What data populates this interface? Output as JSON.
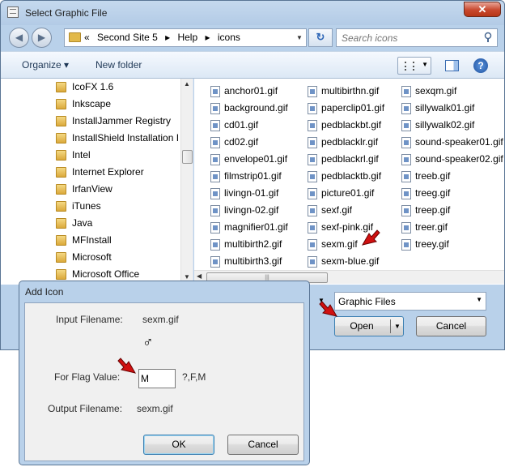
{
  "window": {
    "title": "Select Graphic File",
    "close_glyph": "✕"
  },
  "nav": {
    "back_glyph": "◀",
    "forward_glyph": "▶",
    "crumbs": [
      "«",
      "Second Site 5",
      "▸",
      "Help",
      "▸",
      "icons"
    ],
    "refresh_glyph": "↻",
    "search_placeholder": "Search icons"
  },
  "toolbar": {
    "organize": "Organize ▾",
    "new_folder": "New folder",
    "help": "?"
  },
  "tree": {
    "items": [
      "IcoFX 1.6",
      "Inkscape",
      "InstallJammer Registry",
      "InstallShield Installation I",
      "Intel",
      "Internet Explorer",
      "IrfanView",
      "iTunes",
      "Java",
      "MFInstall",
      "Microsoft",
      "Microsoft Office"
    ]
  },
  "files": {
    "col1": [
      "anchor01.gif",
      "background.gif",
      "cd01.gif",
      "cd02.gif",
      "envelope01.gif",
      "filmstrip01.gif",
      "livingn-01.gif",
      "livingn-02.gif",
      "magnifier01.gif",
      "multibirth2.gif",
      "multibirth3.gif"
    ],
    "col2": [
      "multibirthn.gif",
      "paperclip01.gif",
      "pedblackbt.gif",
      "pedblacklr.gif",
      "pedblackrl.gif",
      "pedblacktb.gif",
      "picture01.gif",
      "sexf.gif",
      "sexf-pink.gif",
      "sexm.gif",
      "sexm-blue.gif"
    ],
    "col3": [
      "sexqm.gif",
      "sillywalk01.gif",
      "sillywalk02.gif",
      "sound-speaker01.gif",
      "sound-speaker02.gif",
      "treeb.gif",
      "treeg.gif",
      "treep.gif",
      "treer.gif",
      "treey.gif"
    ]
  },
  "bottom": {
    "file_type": "Graphic Files",
    "open": "Open",
    "cancel": "Cancel"
  },
  "dialog": {
    "title": "Add Icon",
    "input_filename_label": "Input Filename:",
    "input_filename_value": "sexm.gif",
    "symbol": "♂",
    "flag_label": "For Flag Value:",
    "flag_value": "M",
    "flag_hint": "?,F,M",
    "output_filename_label": "Output Filename:",
    "output_filename_value": "sexm.gif",
    "ok": "OK",
    "cancel": "Cancel"
  },
  "colors": {
    "frame": "#b9d1ea",
    "pointer": "#d01010"
  }
}
